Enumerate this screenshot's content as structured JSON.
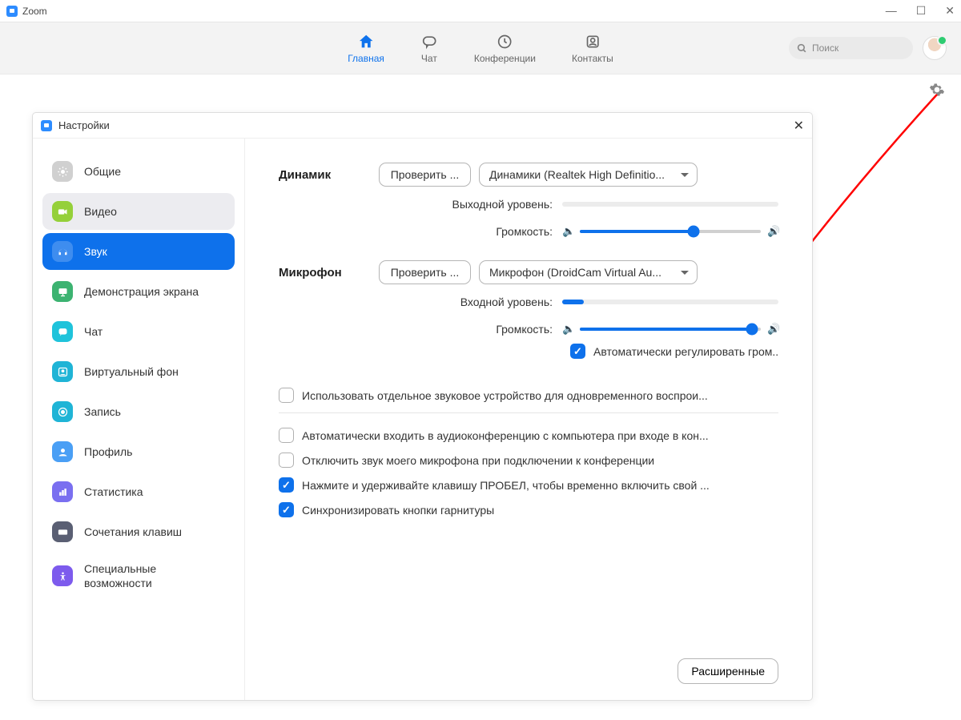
{
  "window": {
    "title": "Zoom"
  },
  "nav": {
    "home": "Главная",
    "chat": "Чат",
    "meetings": "Конференции",
    "contacts": "Контакты",
    "search_placeholder": "Поиск"
  },
  "dialog": {
    "title": "Настройки",
    "sidebar": [
      {
        "id": "general",
        "label": "Общие",
        "color": "gray"
      },
      {
        "id": "video",
        "label": "Видео",
        "color": "green"
      },
      {
        "id": "audio",
        "label": "Звук",
        "color": "blue"
      },
      {
        "id": "share",
        "label": "Демонстрация экрана",
        "color": "greendark"
      },
      {
        "id": "chat",
        "label": "Чат",
        "color": "cyan"
      },
      {
        "id": "vbg",
        "label": "Виртуальный фон",
        "color": "teal"
      },
      {
        "id": "record",
        "label": "Запись",
        "color": "teal"
      },
      {
        "id": "profile",
        "label": "Профиль",
        "color": "bluel"
      },
      {
        "id": "stats",
        "label": "Статистика",
        "color": "purple"
      },
      {
        "id": "shortcuts",
        "label": "Сочетания клавиш",
        "color": "dark"
      },
      {
        "id": "access",
        "label": "Специальные возможности",
        "color": "violet"
      }
    ],
    "speaker": {
      "label": "Динамик",
      "test": "Проверить ...",
      "device": "Динамики (Realtek High Definitio...",
      "output_level_label": "Выходной уровень:",
      "volume_label": "Громкость:",
      "output_level_pct": 0,
      "volume_pct": 63
    },
    "mic": {
      "label": "Микрофон",
      "test": "Проверить ...",
      "device": "Микрофон (DroidCam Virtual Au...",
      "input_level_label": "Входной уровень:",
      "volume_label": "Громкость:",
      "input_level_pct": 10,
      "volume_pct": 95,
      "auto_adjust": "Автоматически регулировать гром..."
    },
    "options": {
      "separate_device": "Использовать отдельное звуковое устройство для одновременного воспрои...",
      "auto_join_audio": "Автоматически входить в аудиоконференцию с компьютера при входе в кон...",
      "mute_on_join": "Отключить звук моего микрофона при подключении к конференции",
      "push_to_talk": "Нажмите и удерживайте клавишу ПРОБЕЛ, чтобы временно включить свой ...",
      "sync_headset": "Синхронизировать кнопки гарнитуры"
    },
    "advanced": "Расширенные"
  }
}
